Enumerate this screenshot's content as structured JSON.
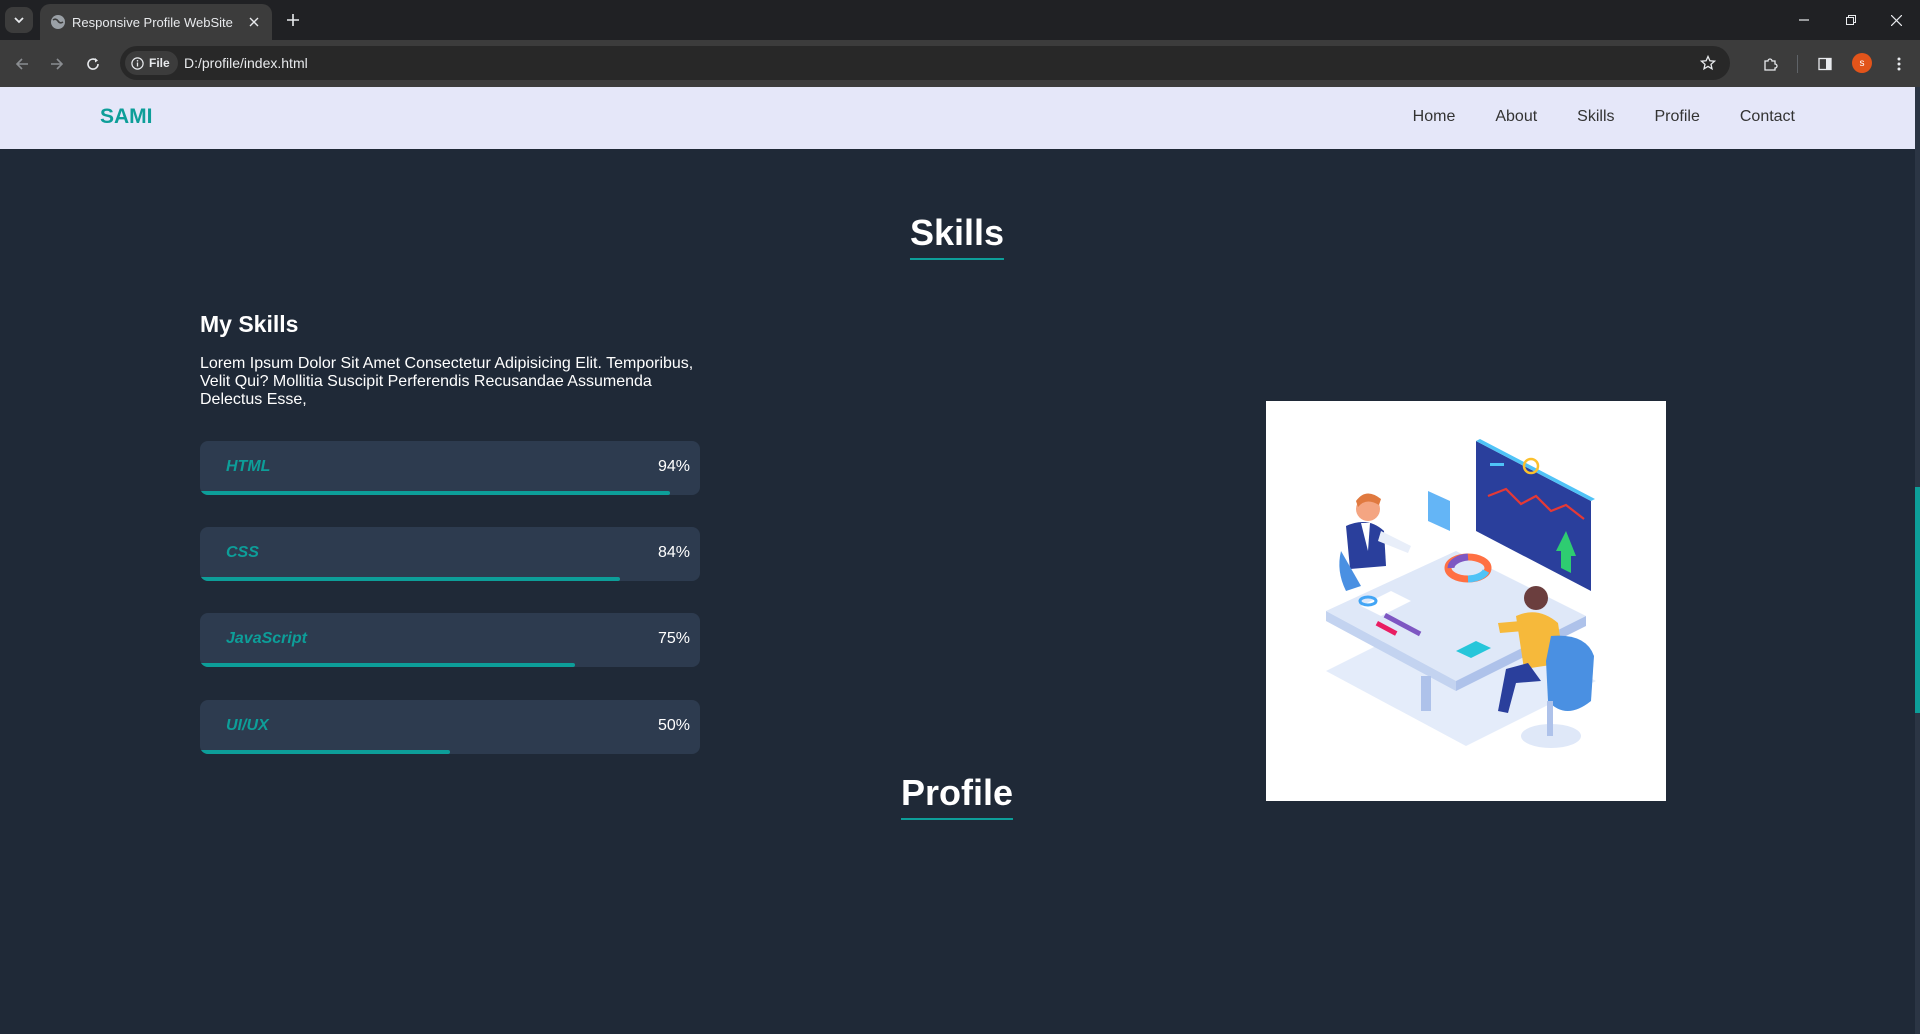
{
  "browser": {
    "tab_title": "Responsive Profile WebSite",
    "site_chip": "File",
    "url": "D:/profile/index.html",
    "avatar_letter": "s"
  },
  "nav": {
    "logo": "SAMI",
    "links": [
      "Home",
      "About",
      "Skills",
      "Profile",
      "Contact"
    ]
  },
  "skills_section": {
    "title": "Skills",
    "heading": "My Skills",
    "description": "Lorem Ipsum Dolor Sit Amet Consectetur Adipisicing Elit. Temporibus, Velit Qui? Mollitia Suscipit Perferendis Recusandae Assumenda Delectus Esse,",
    "skills": [
      {
        "name": "HTML",
        "percent_label": "94%",
        "level": 0.94
      },
      {
        "name": "CSS",
        "percent_label": "84%",
        "level": 0.84
      },
      {
        "name": "JavaScript",
        "percent_label": "75%",
        "level": 0.75
      },
      {
        "name": "UI/UX",
        "percent_label": "50%",
        "level": 0.5
      }
    ]
  },
  "profile_section": {
    "title": "Profile"
  },
  "colors": {
    "accent": "#0d9e99",
    "page_bg": "#1f2937",
    "nav_bg": "#e5e7f9",
    "skill_card_bg": "#2d3b4f"
  }
}
